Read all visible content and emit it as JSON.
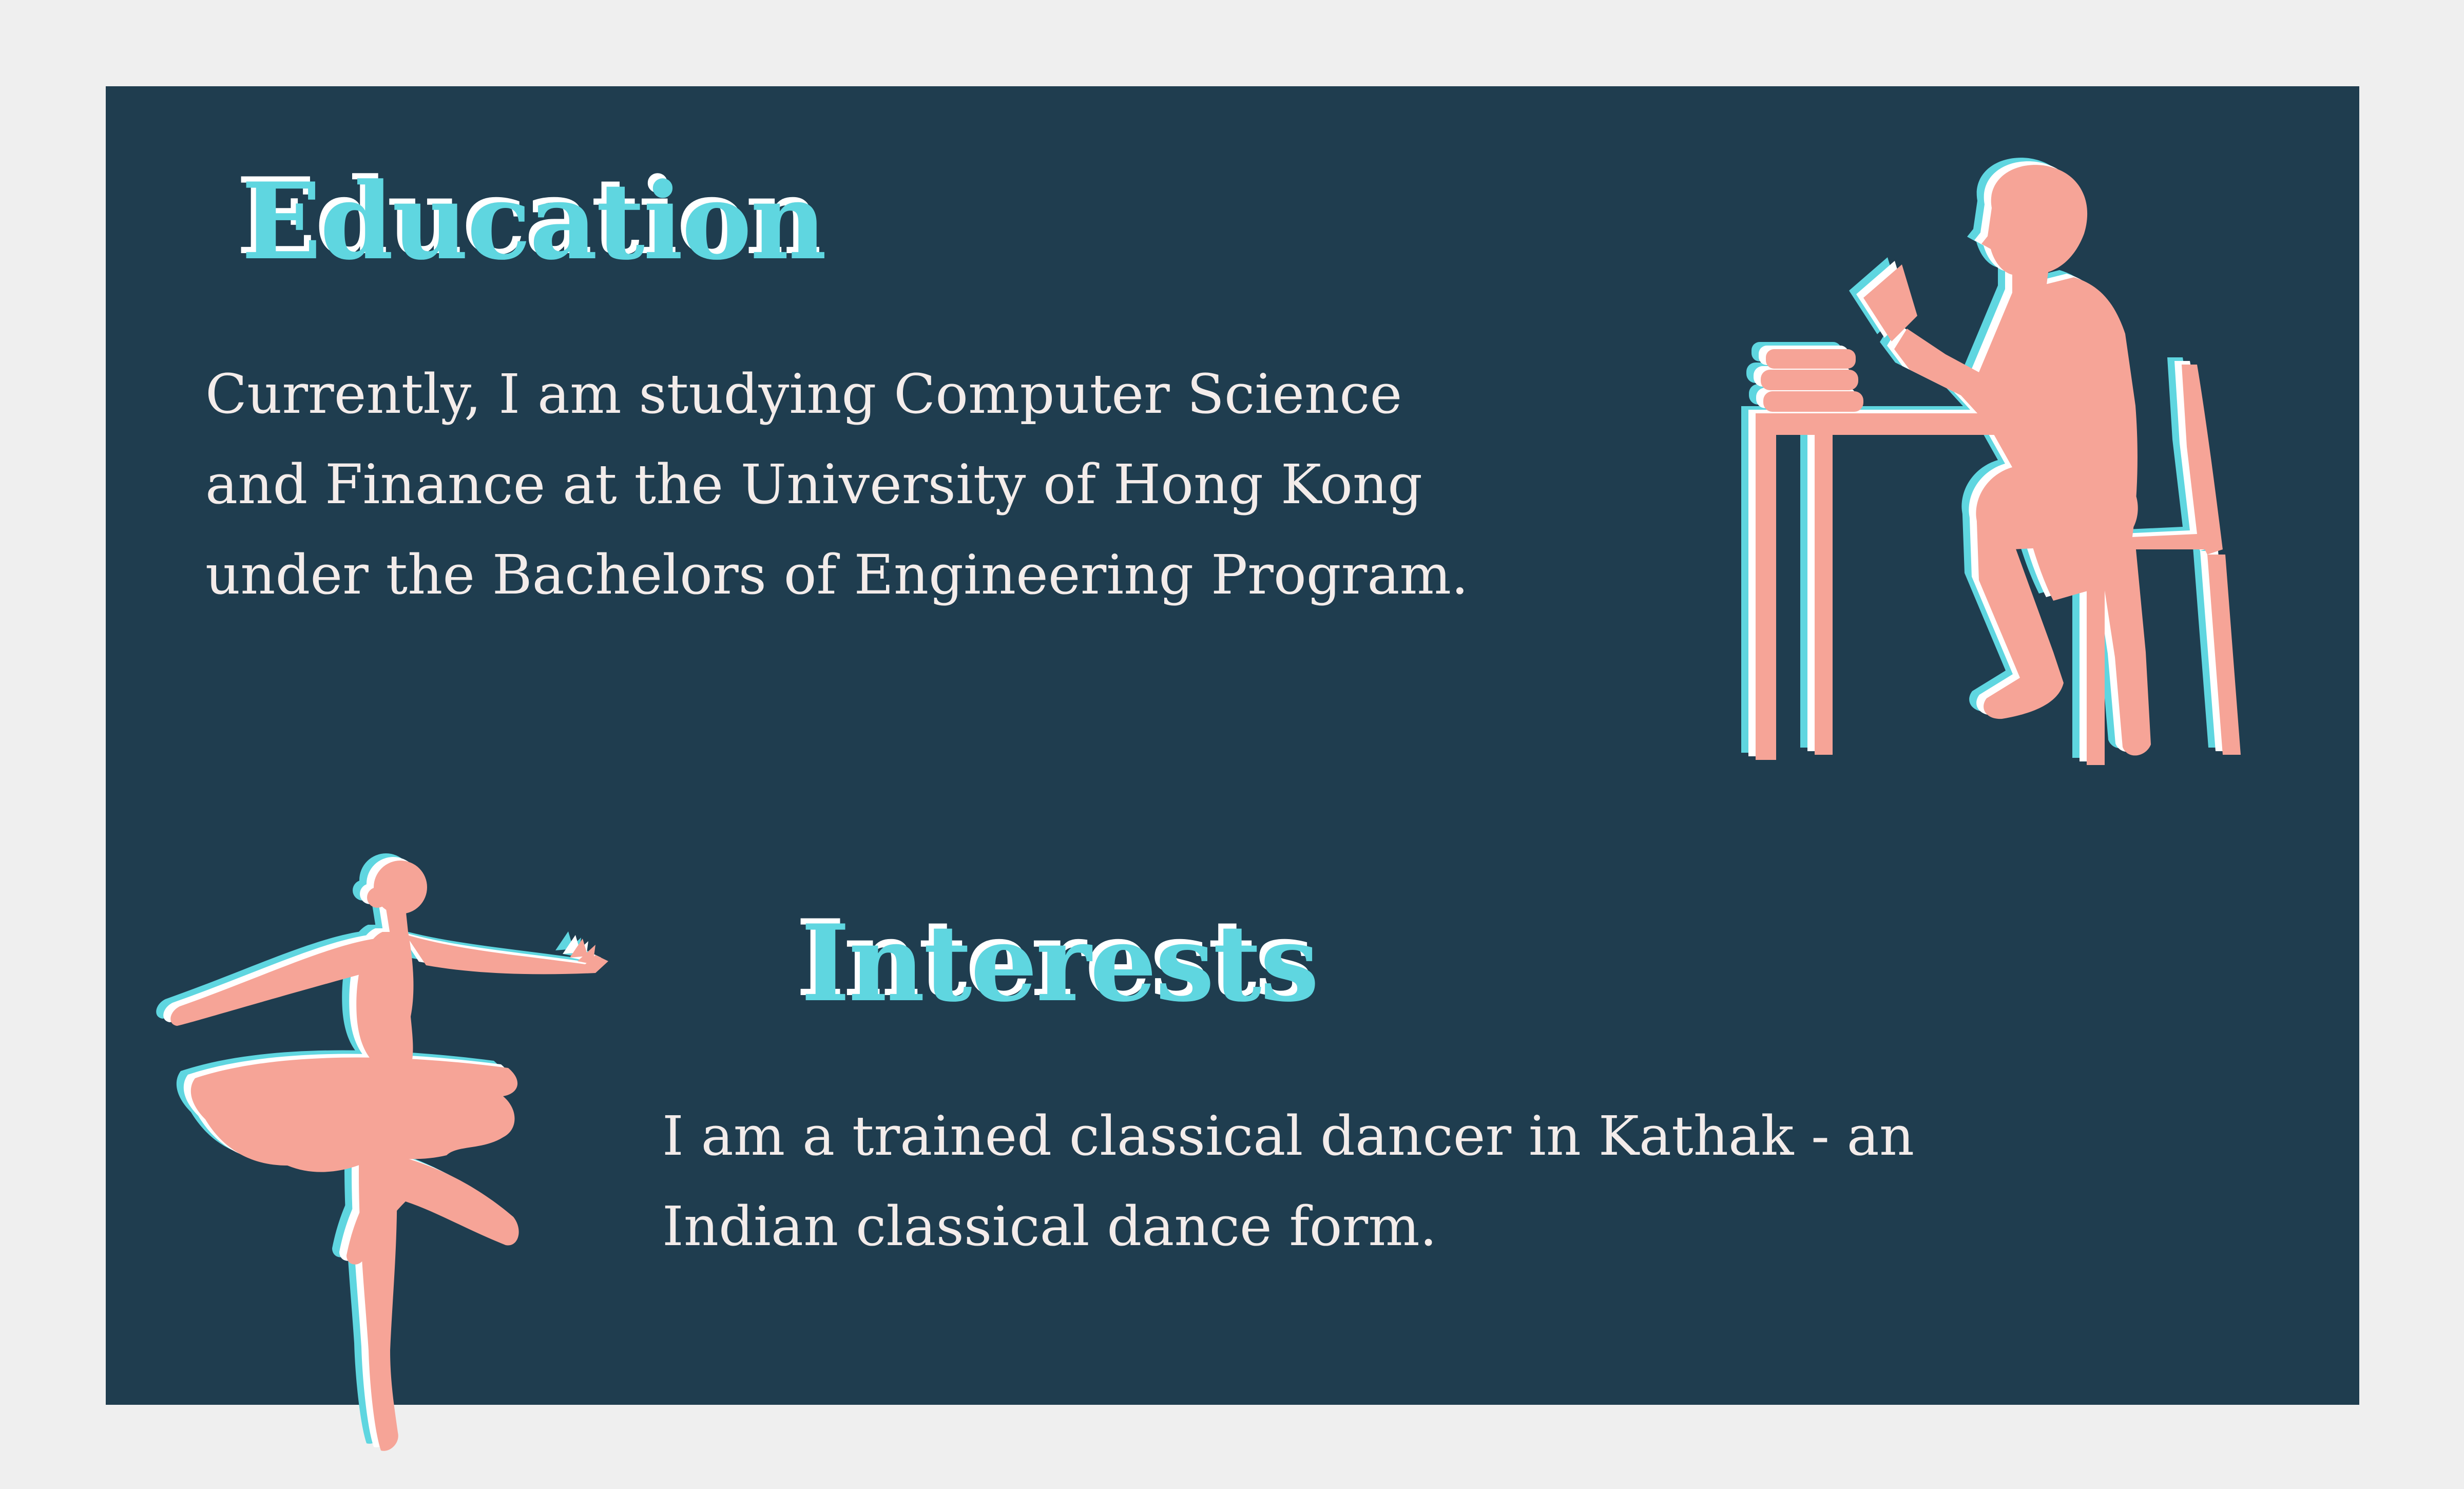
{
  "colors": {
    "page_background": "#efefef",
    "card_background": "#1f3d4f",
    "heading_color": "#5fd6e0",
    "heading_outline": "#ffffff",
    "body_text_color": "#f3ecea",
    "silhouette_fill": "#f6a497",
    "silhouette_cyan": "#5fd6e0",
    "silhouette_white": "#ffffff"
  },
  "education": {
    "heading": "Education",
    "lines": [
      "Currently, I am studying Computer Science",
      "and Finance at the University of Hong Kong",
      "under the Bachelors of Engineering Program."
    ],
    "illustration_icon": "student-reading-at-desk-silhouette"
  },
  "interests": {
    "heading": "Interests",
    "lines": [
      "I am a trained classical dancer in Kathak - an",
      "Indian classical dance form."
    ],
    "illustration_icon": "ballerina-silhouette"
  }
}
